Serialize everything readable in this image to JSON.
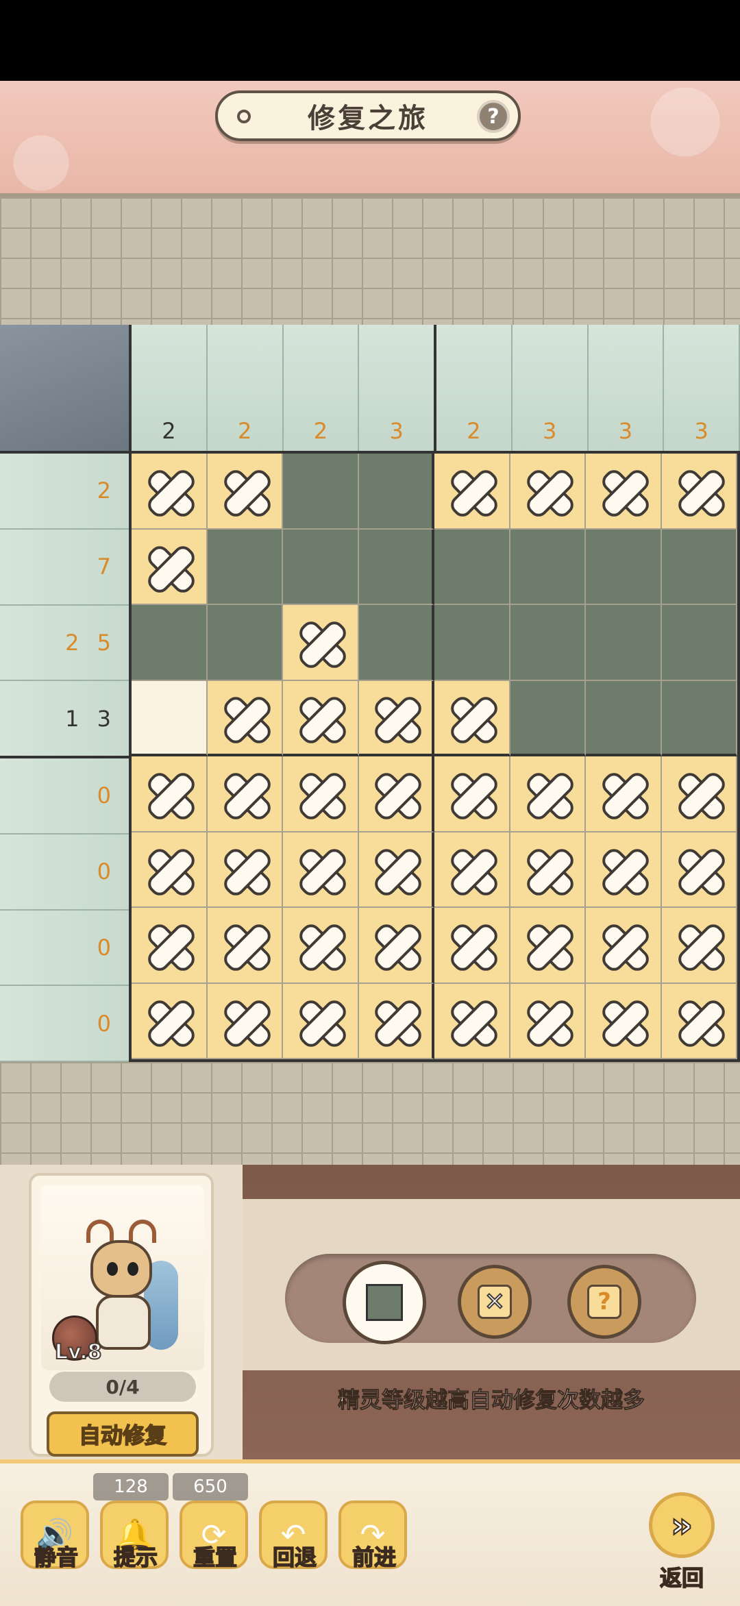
{
  "header": {
    "title": "修复之旅",
    "help_icon": "?"
  },
  "puzzle": {
    "col_clues": [
      {
        "text": "2",
        "done": true
      },
      {
        "text": "2",
        "done": false
      },
      {
        "text": "2",
        "done": false
      },
      {
        "text": "3",
        "done": false
      },
      {
        "text": "2",
        "done": false
      },
      {
        "text": "3",
        "done": false
      },
      {
        "text": "3",
        "done": false
      },
      {
        "text": "3",
        "done": false
      }
    ],
    "row_clues": [
      {
        "text": "2",
        "done": false
      },
      {
        "text": "7",
        "done": false
      },
      {
        "text": "2 5",
        "done": false
      },
      {
        "text": "1 3",
        "done": true
      },
      {
        "text": "0",
        "done": false
      },
      {
        "text": "0",
        "done": false
      },
      {
        "text": "0",
        "done": false
      },
      {
        "text": "0",
        "done": false
      }
    ],
    "grid": [
      [
        "X",
        "X",
        "F",
        "F",
        "X",
        "X",
        "X",
        "X"
      ],
      [
        "X",
        "F",
        "F",
        "F",
        "F",
        "F",
        "F",
        "F"
      ],
      [
        "F",
        "F",
        "X",
        "F",
        "F",
        "F",
        "F",
        "F"
      ],
      [
        "E",
        "X",
        "X",
        "X",
        "X",
        "F",
        "F",
        "F"
      ],
      [
        "X",
        "X",
        "X",
        "X",
        "X",
        "X",
        "X",
        "X"
      ],
      [
        "X",
        "X",
        "X",
        "X",
        "X",
        "X",
        "X",
        "X"
      ],
      [
        "X",
        "X",
        "X",
        "X",
        "X",
        "X",
        "X",
        "X"
      ],
      [
        "X",
        "X",
        "X",
        "X",
        "X",
        "X",
        "X",
        "X"
      ]
    ]
  },
  "sprite": {
    "level": "Lv.8",
    "progress": "0/4",
    "auto_repair_label": "自动修复"
  },
  "tools": {
    "hint_text": "精灵等级越高自动修复次数越多"
  },
  "bottom_bar": {
    "mute_label": "静音",
    "hint_label": "提示",
    "hint_count": "128",
    "reset_label": "重置",
    "reset_count": "650",
    "undo_label": "回退",
    "redo_label": "前进",
    "back_label": "返回"
  },
  "colors": {
    "filled": "#6e7c6c",
    "cross_bg": "#f7dc9a",
    "clue_pending": "#d98a2b",
    "clue_done": "#333333"
  }
}
